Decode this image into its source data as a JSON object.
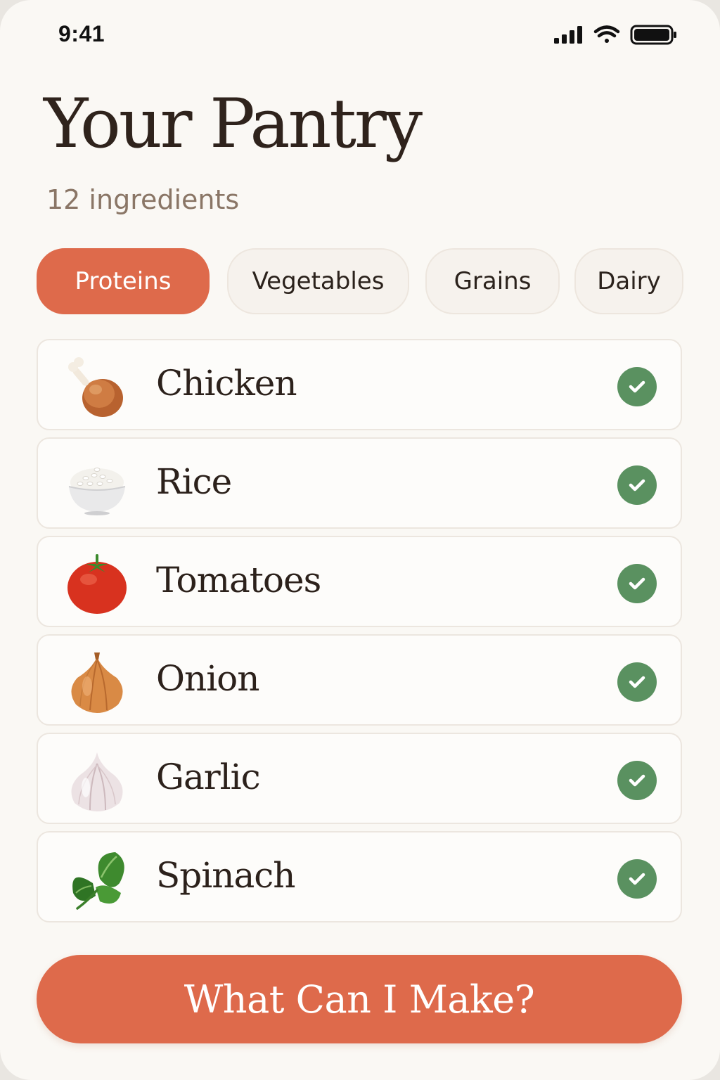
{
  "status_bar": {
    "time": "9:41"
  },
  "header": {
    "title": "Your Pantry",
    "subtitle": "12 ingredients"
  },
  "categories": [
    {
      "label": "Proteins",
      "selected": true
    },
    {
      "label": "Vegetables",
      "selected": false
    },
    {
      "label": "Grains",
      "selected": false
    },
    {
      "label": "Dairy",
      "selected": false
    }
  ],
  "ingredients": [
    {
      "name": "Chicken",
      "icon": "chicken-leg-icon",
      "checked": true
    },
    {
      "name": "Rice",
      "icon": "rice-bowl-icon",
      "checked": true
    },
    {
      "name": "Tomatoes",
      "icon": "tomato-icon",
      "checked": true
    },
    {
      "name": "Onion",
      "icon": "onion-icon",
      "checked": true
    },
    {
      "name": "Garlic",
      "icon": "garlic-icon",
      "checked": true
    },
    {
      "name": "Spinach",
      "icon": "spinach-icon",
      "checked": true
    }
  ],
  "cta": {
    "label": "What Can I Make?"
  },
  "colors": {
    "accent": "#de6a4b",
    "check": "#5a9160",
    "background": "#faf8f4",
    "title_text": "#2f231c",
    "subtitle_text": "#8a7666"
  }
}
